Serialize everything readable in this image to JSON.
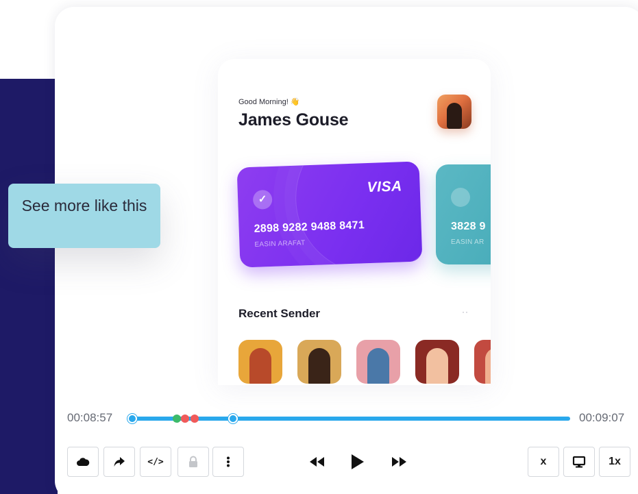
{
  "app": {
    "greeting": "Good Morning!",
    "greeting_emoji": "👋",
    "user_name": "James Gouse",
    "cards": [
      {
        "brand": "VISA",
        "number": "2898 9282 9488 8471",
        "holder": "EASIN ARAFAT",
        "color": "#7a2ff0"
      },
      {
        "brand": "",
        "number": "3828 9",
        "holder": "EASIN AR",
        "color": "#3ea6b4"
      }
    ],
    "section_title": "Recent Sender",
    "more_glyph": "··",
    "senders_count_visible": 5
  },
  "overlay": {
    "see_more_label": "See more like this"
  },
  "player": {
    "current_time": "00:08:57",
    "end_time": "00:09:07",
    "progress_fraction": 0.24,
    "accent_color": "#2aa8ec",
    "marker_colors": [
      "#3cba6a",
      "#f05a5a",
      "#f05a5a"
    ],
    "toolbar_left": [
      {
        "icon": "cloud-icon",
        "enabled": true
      },
      {
        "icon": "share-arrow-icon",
        "enabled": true
      },
      {
        "icon": "code-icon",
        "label": "</>",
        "enabled": true
      },
      {
        "icon": "lock-icon",
        "enabled": false
      },
      {
        "icon": "vertical-ellipsis-icon",
        "enabled": true
      }
    ],
    "transport": [
      "rewind-icon",
      "play-icon",
      "fast-forward-icon"
    ],
    "toolbar_right": {
      "close_label": "x",
      "display_icon": "monitor-icon",
      "speed_label": "1x"
    }
  }
}
